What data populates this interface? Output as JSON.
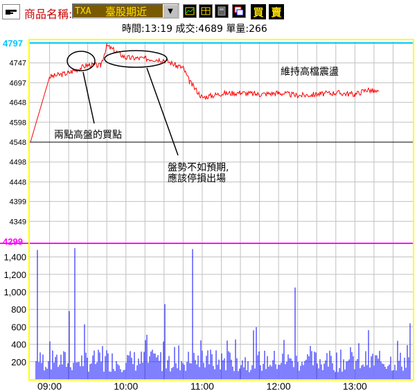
{
  "toolbar": {
    "product_label": "商品名稱:",
    "product_code": "TXA",
    "product_name": "臺股期近",
    "buy_label": "買",
    "sell_label": "賣"
  },
  "status": {
    "time_label": "時間:",
    "time": "13:19",
    "trade_label": "成交:",
    "trade": "4689",
    "volume_label": "單量:",
    "volume": "266"
  },
  "annotations": {
    "double_high": "兩點高盤的買點",
    "weak_line1": "盤勢不如預期,",
    "weak_line2": "應該停損出場",
    "keep_high": "維持高檔震盪"
  },
  "colors": {
    "price_line": "#ff0000",
    "volume_bar": "#0000ff",
    "grid": "#c0c0c0",
    "axis_highlight_top": "#00c8ff",
    "axis_highlight_bottom": "#ff00ff",
    "chart_border": "#ffff00"
  },
  "chart_data": [
    {
      "type": "line",
      "title": "",
      "x": [
        "08:45",
        "09:00",
        "09:15",
        "09:30",
        "09:40",
        "09:45",
        "10:00",
        "10:15",
        "10:30",
        "10:40",
        "10:45",
        "10:50",
        "11:00",
        "11:15",
        "11:30",
        "11:45",
        "12:00",
        "12:15",
        "12:30",
        "12:45",
        "13:00",
        "13:10",
        "13:19"
      ],
      "series": [
        {
          "values": [
            4548,
            4712,
            4722,
            4742,
            4740,
            4790,
            4760,
            4758,
            4755,
            4740,
            4735,
            4700,
            4660,
            4670,
            4672,
            4668,
            4672,
            4665,
            4668,
            4672,
            4668,
            4680,
            4672
          ]
        }
      ],
      "xticks": [
        "09:00",
        "10:00",
        "11:00",
        "12:00",
        "13:00"
      ],
      "yticks": [
        "4797",
        "4747",
        "4697",
        "4648",
        "4598",
        "4548",
        "4498",
        "4448",
        "4399",
        "4349",
        "4299"
      ],
      "ylim": [
        4299,
        4797
      ],
      "reference_line": 4548
    },
    {
      "type": "bar",
      "title": "",
      "yticks": [
        "200",
        "400",
        "600",
        "800",
        "1,000",
        "1,200",
        "1,400"
      ],
      "ylim": [
        0,
        1500
      ],
      "peaks": [
        1480,
        1500,
        1490,
        1050
      ]
    }
  ]
}
